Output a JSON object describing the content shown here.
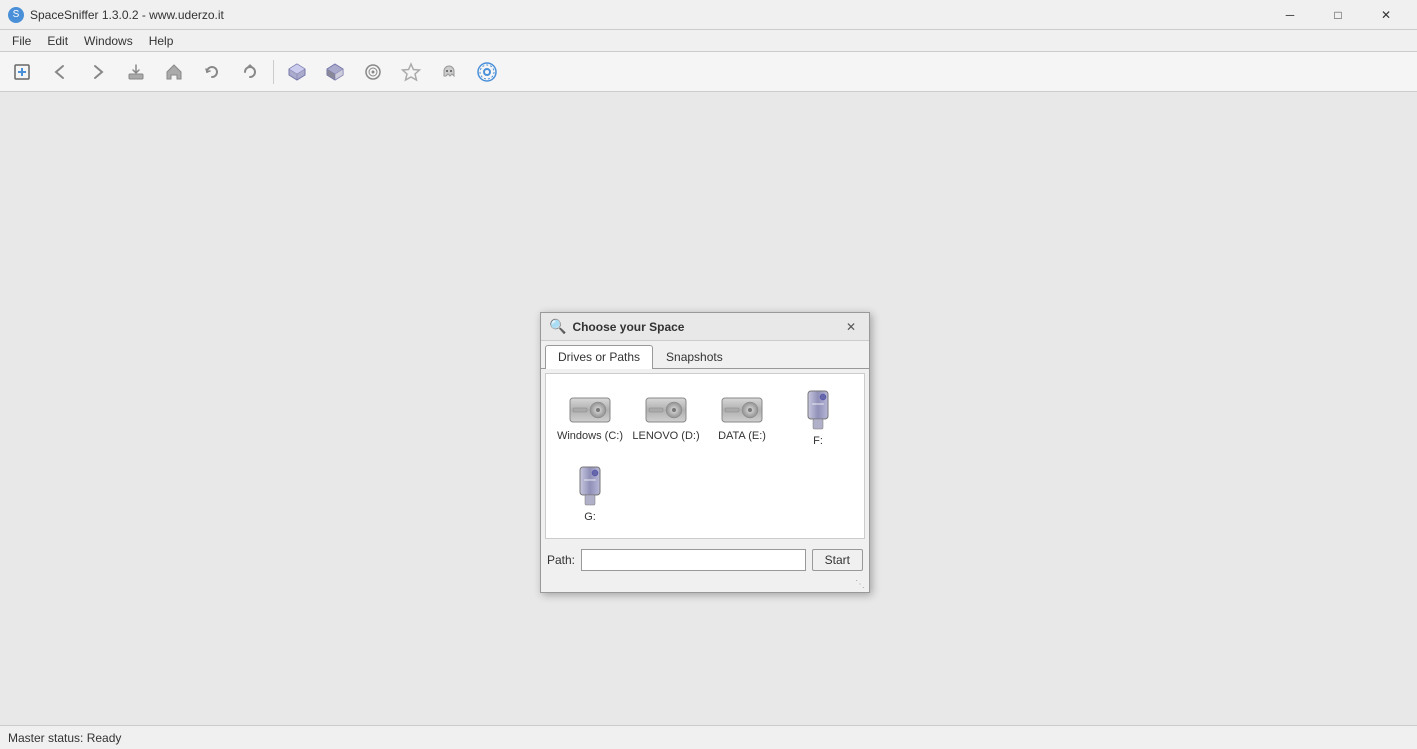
{
  "window": {
    "title": "SpaceSniffer 1.3.0.2 - www.uderzo.it",
    "icon": "🔵",
    "minimize_label": "─",
    "maximize_label": "□",
    "close_label": "✕"
  },
  "menu": {
    "items": [
      {
        "id": "file",
        "label": "File"
      },
      {
        "id": "edit",
        "label": "Edit"
      },
      {
        "id": "windows",
        "label": "Windows"
      },
      {
        "id": "help",
        "label": "Help"
      }
    ]
  },
  "toolbar": {
    "buttons": [
      {
        "id": "new",
        "icon": "➕",
        "label": "New"
      },
      {
        "id": "back",
        "icon": "◀",
        "label": "Back"
      },
      {
        "id": "forward",
        "icon": "▶",
        "label": "Forward"
      },
      {
        "id": "export",
        "icon": "📤",
        "label": "Export"
      },
      {
        "id": "home",
        "icon": "🏠",
        "label": "Home"
      },
      {
        "id": "refresh",
        "icon": "🔄",
        "label": "Refresh"
      },
      {
        "id": "refresh2",
        "icon": "↻",
        "label": "Refresh2"
      },
      {
        "id": "cube1",
        "icon": "⬡",
        "label": "Cube1"
      },
      {
        "id": "cube2",
        "icon": "⬡",
        "label": "Cube2"
      },
      {
        "id": "target",
        "icon": "◎",
        "label": "Target"
      },
      {
        "id": "star",
        "icon": "☆",
        "label": "Star"
      },
      {
        "id": "ghost",
        "icon": "👻",
        "label": "Ghost"
      },
      {
        "id": "settings",
        "icon": "⚙",
        "label": "Settings"
      }
    ]
  },
  "dialog": {
    "title": "Choose your Space",
    "tabs": [
      {
        "id": "drives",
        "label": "Drives or Paths",
        "active": true
      },
      {
        "id": "snapshots",
        "label": "Snapshots",
        "active": false
      }
    ],
    "drives": [
      {
        "id": "c",
        "label": "Windows (C:)",
        "type": "hdd"
      },
      {
        "id": "d",
        "label": "LENOVO (D:)",
        "type": "hdd"
      },
      {
        "id": "e",
        "label": "DATA (E:)",
        "type": "hdd"
      },
      {
        "id": "f",
        "label": "F:",
        "type": "usb"
      },
      {
        "id": "g",
        "label": "G:",
        "type": "usb"
      }
    ],
    "path_label": "Path:",
    "path_placeholder": "",
    "start_label": "Start",
    "resize_handle": "⋱"
  },
  "status_bar": {
    "text": "Master status: Ready"
  }
}
